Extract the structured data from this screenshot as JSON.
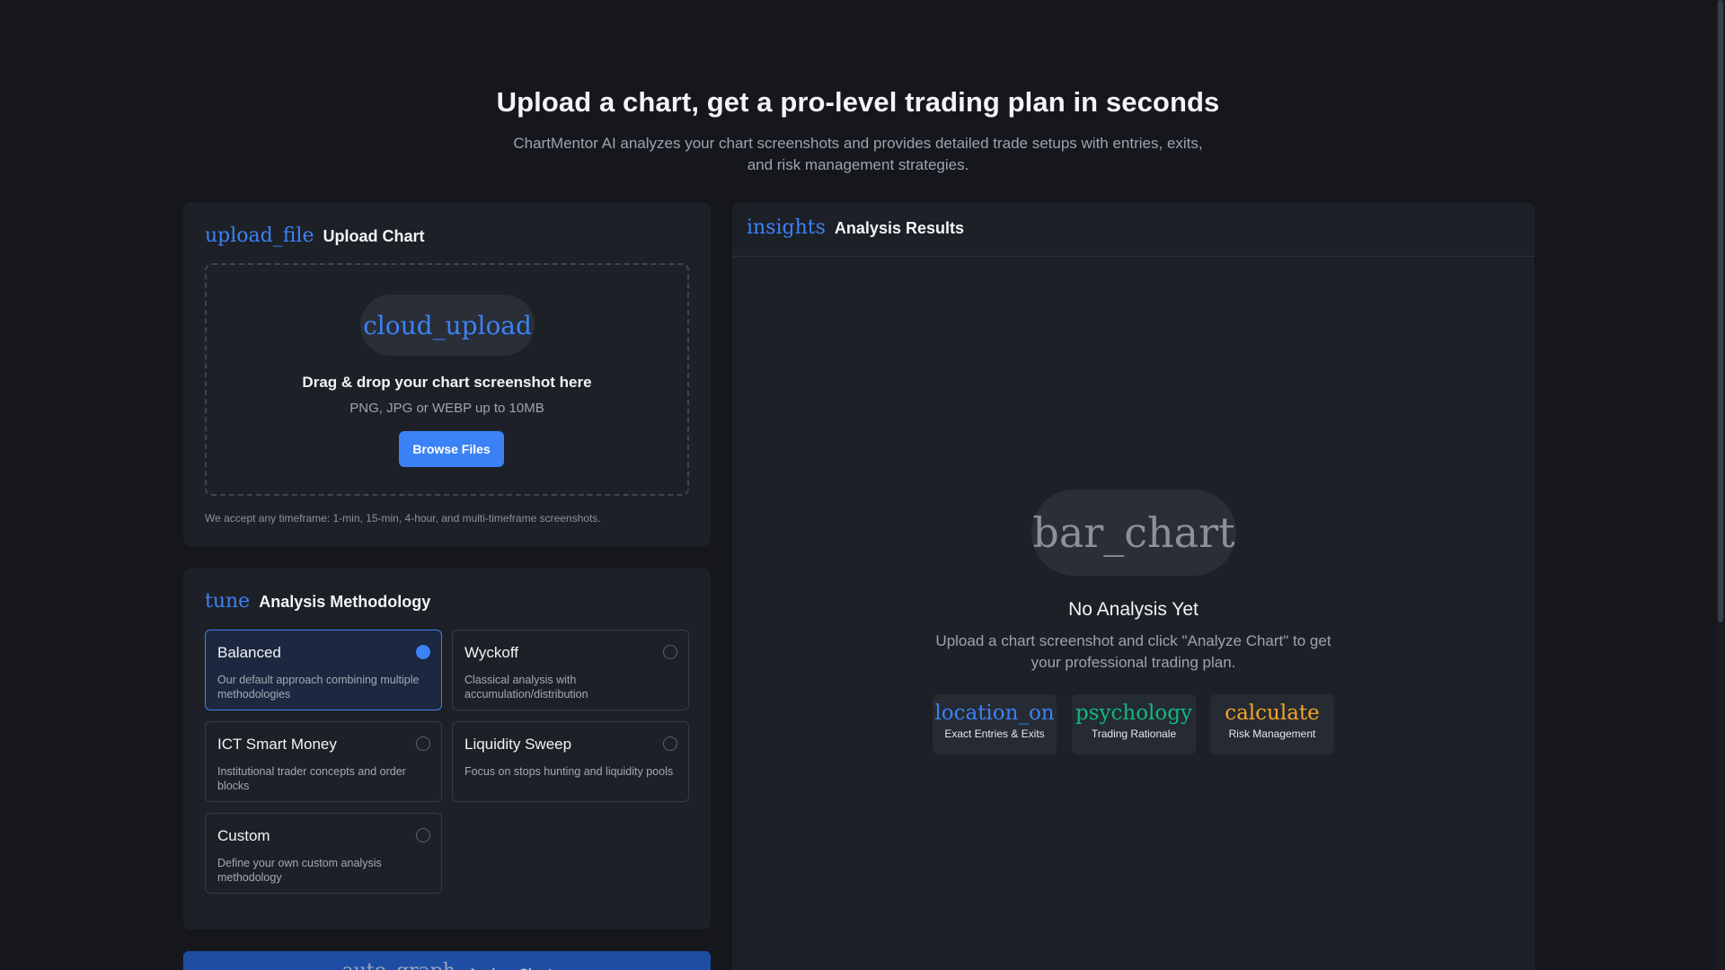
{
  "hero": {
    "title": "Upload a chart, get a pro-level trading plan in seconds",
    "subtitle": "ChartMentor AI analyzes your chart screenshots and provides detailed trade setups with entries, exits, and risk management strategies."
  },
  "upload": {
    "icon": "upload_file",
    "title": "Upload Chart",
    "cloud_icon": "cloud_upload",
    "drop_title": "Drag & drop your chart screenshot here",
    "drop_sub": "PNG, JPG or WEBP up to 10MB",
    "browse_label": "Browse Files",
    "note": "We accept any timeframe: 1-min, 15-min, 4-hour, and multi-timeframe screenshots."
  },
  "methodology": {
    "icon": "tune",
    "title": "Analysis Methodology",
    "options": [
      {
        "name": "Balanced",
        "desc": "Our default approach combining multiple methodologies",
        "selected": true
      },
      {
        "name": "Wyckoff",
        "desc": "Classical analysis with accumulation/distribution",
        "selected": false
      },
      {
        "name": "ICT Smart Money",
        "desc": "Institutional trader concepts and order blocks",
        "selected": false
      },
      {
        "name": "Liquidity Sweep",
        "desc": "Focus on stops hunting and liquidity pools",
        "selected": false
      },
      {
        "name": "Custom",
        "desc": "Define your own custom analysis methodology",
        "selected": false
      }
    ]
  },
  "analyze": {
    "icon": "auto_graph",
    "label": "Analyze Chart"
  },
  "results": {
    "icon": "insights",
    "title": "Analysis Results",
    "empty_icon": "bar_chart",
    "empty_title": "No Analysis Yet",
    "empty_desc": "Upload a chart screenshot and click \"Analyze Chart\" to get your professional trading plan.",
    "features": [
      {
        "icon": "location_on",
        "label": "Exact Entries & Exits",
        "color": "#3b82f6"
      },
      {
        "icon": "psychology",
        "label": "Trading Rationale",
        "color": "#10b981"
      },
      {
        "icon": "calculate",
        "label": "Risk Management",
        "color": "#f5a524"
      }
    ]
  },
  "colors": {
    "background": "#15171c",
    "panel": "#1d2027",
    "accent": "#3b82f6",
    "selected_bg": "#1c2740",
    "analyze_button": "#1e4ea4"
  }
}
